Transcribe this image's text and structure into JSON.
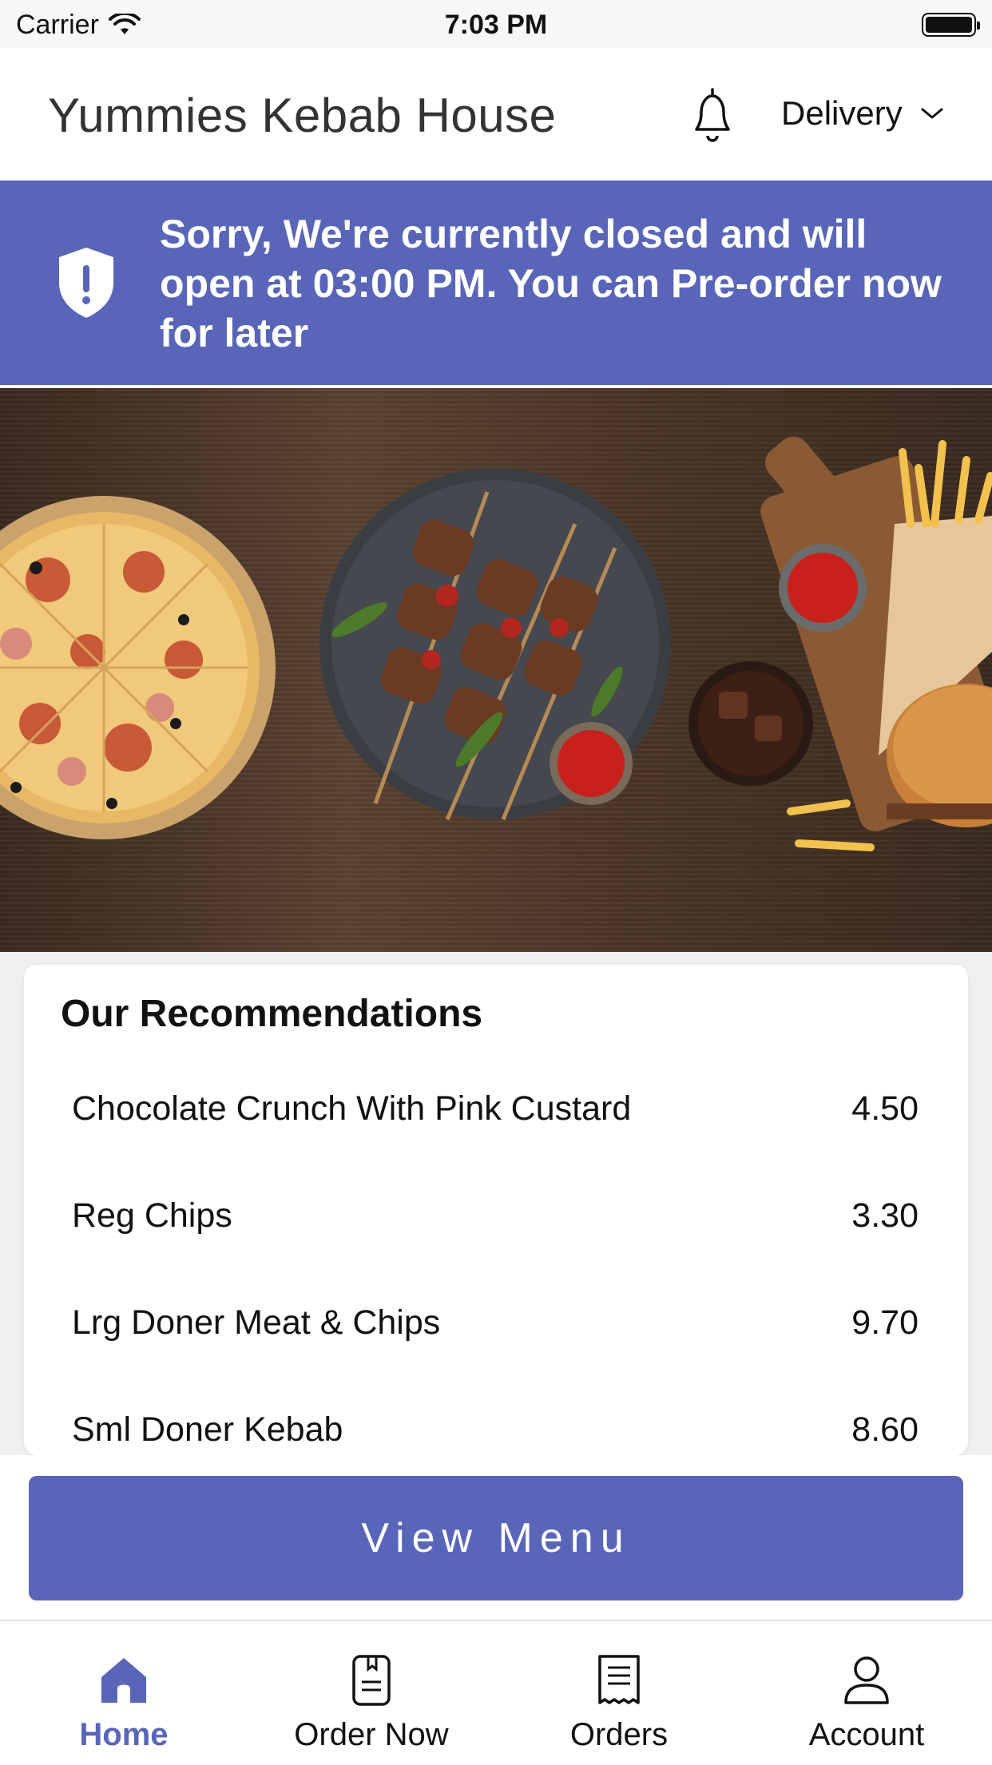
{
  "status_bar": {
    "carrier": "Carrier",
    "time": "7:03 PM"
  },
  "header": {
    "title": "Yummies Kebab House",
    "order_mode": "Delivery"
  },
  "banner": {
    "message": "Sorry, We're currently closed and will open at 03:00 PM. You can Pre-order now for later"
  },
  "recommendations": {
    "title": "Our Recommendations",
    "items": [
      {
        "name": "Chocolate Crunch With Pink Custard",
        "price": "4.50"
      },
      {
        "name": "Reg Chips",
        "price": "3.30"
      },
      {
        "name": "Lrg Doner Meat & Chips",
        "price": "9.70"
      },
      {
        "name": "Sml Doner Kebab",
        "price": "8.60"
      }
    ]
  },
  "cta": {
    "label": "View Menu"
  },
  "tabs": [
    {
      "label": "Home",
      "icon": "home-icon",
      "active": true
    },
    {
      "label": "Order Now",
      "icon": "book-icon",
      "active": false
    },
    {
      "label": "Orders",
      "icon": "receipt-icon",
      "active": false
    },
    {
      "label": "Account",
      "icon": "user-icon",
      "active": false
    }
  ],
  "colors": {
    "brand": "#5865b8",
    "text": "#111111",
    "background": "#f0f0f2"
  }
}
